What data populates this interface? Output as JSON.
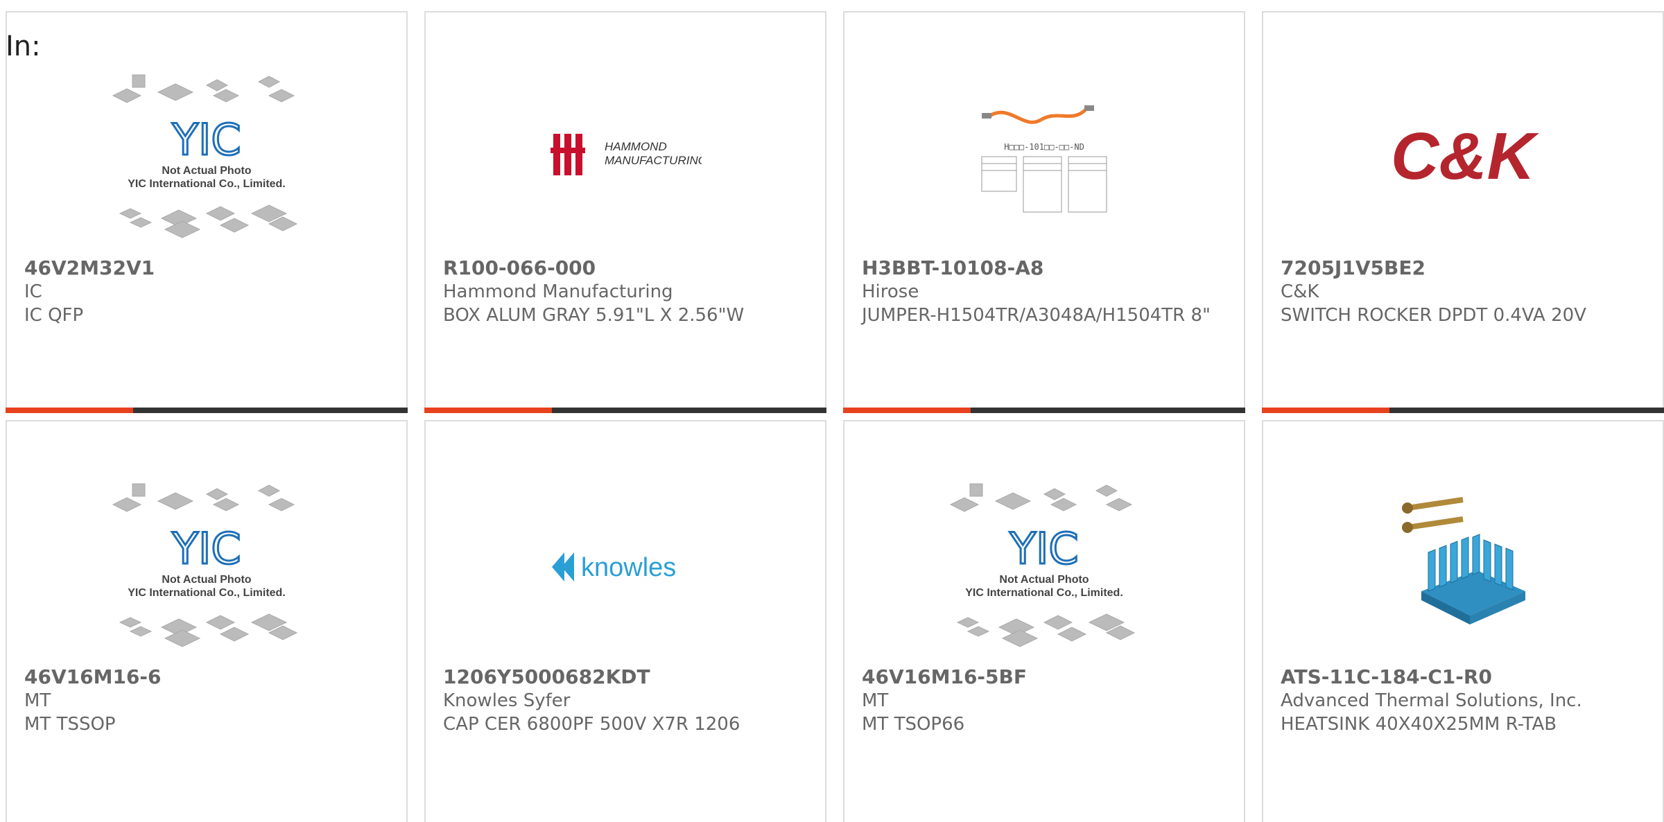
{
  "header": {
    "label": "In:"
  },
  "products": [
    {
      "part_number": "46V2M32V1",
      "manufacturer": "IC",
      "description": "IC QFP",
      "image": {
        "type": "yic",
        "caption_line1": "Not Actual Photo",
        "caption_line2": "YIC International Co., Limited.",
        "logo_text": "YIC"
      }
    },
    {
      "part_number": "R100-066-000",
      "manufacturer": "Hammond Manufacturing",
      "description": "BOX ALUM GRAY 5.91\"L X 2.56\"W",
      "image": {
        "type": "hammond",
        "logo_line1": "HAMMOND",
        "logo_line2": "MANUFACTURING."
      }
    },
    {
      "part_number": "H3BBT-10108-A8",
      "manufacturer": "Hirose",
      "description": "JUMPER-H1504TR/A3048A/H1504TR 8\"",
      "image": {
        "type": "cable",
        "diagram_code": "H□□□-101□□-□□-ND"
      }
    },
    {
      "part_number": "7205J1V5BE2",
      "manufacturer": "C&K",
      "description": "SWITCH ROCKER DPDT 0.4VA 20V",
      "image": {
        "type": "ck",
        "logo_text": "C&K"
      }
    },
    {
      "part_number": "46V16M16-6",
      "manufacturer": "MT",
      "description": "MT TSSOP",
      "image": {
        "type": "yic",
        "caption_line1": "Not Actual Photo",
        "caption_line2": "YIC International Co., Limited.",
        "logo_text": "YIC"
      }
    },
    {
      "part_number": "1206Y5000682KDT",
      "manufacturer": "Knowles Syfer",
      "description": "CAP CER 6800PF 500V X7R 1206",
      "image": {
        "type": "knowles",
        "logo_text": "knowles"
      }
    },
    {
      "part_number": "46V16M16-5BF",
      "manufacturer": "MT",
      "description": "MT TSOP66",
      "image": {
        "type": "yic",
        "caption_line1": "Not Actual Photo",
        "caption_line2": "YIC International Co., Limited.",
        "logo_text": "YIC"
      }
    },
    {
      "part_number": "ATS-11C-184-C1-R0",
      "manufacturer": "Advanced Thermal Solutions, Inc.",
      "description": "HEATSINK 40X40X25MM R-TAB",
      "image": {
        "type": "heatsink"
      }
    }
  ],
  "colors": {
    "accent": "#e8411d",
    "bar": "#333333",
    "text": "#666666",
    "border": "#dcdcdc",
    "ck_red": "#b5252e",
    "knowles_blue": "#2a9fd6",
    "yic_blue": "#1d6fb8"
  }
}
